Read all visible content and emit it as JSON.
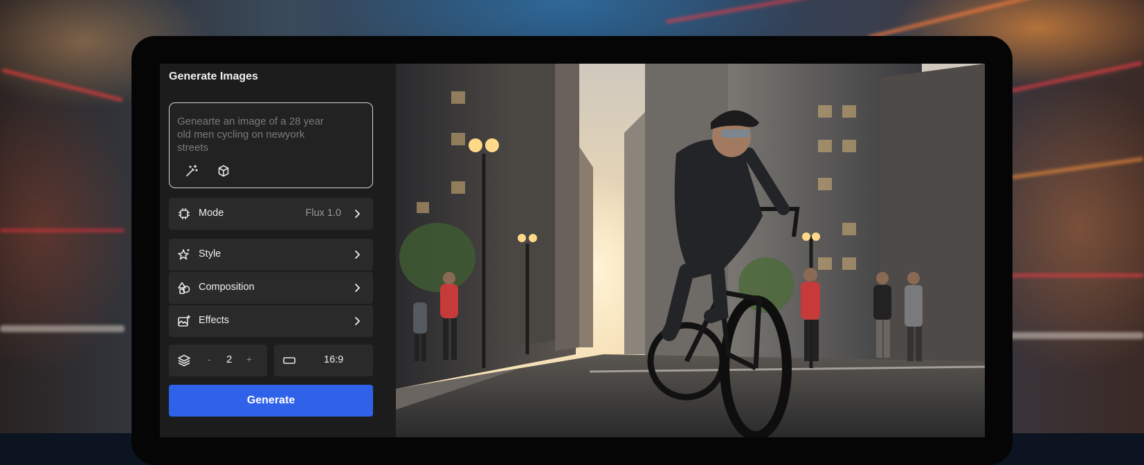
{
  "panel": {
    "title": "Generate Images",
    "prompt": {
      "text": "Genearte an image of a 28 year old men cycling on newyork streets",
      "icons": [
        "magic-wand-icon",
        "cube-icon"
      ]
    },
    "mode": {
      "label": "Mode",
      "value": "Flux 1.0",
      "icon": "chip-icon"
    },
    "style": {
      "label": "Style",
      "icon": "sparkle-star-icon"
    },
    "composition": {
      "label": "Composition",
      "icon": "shapes-icon"
    },
    "effects": {
      "label": "Effects",
      "icon": "image-sparkle-icon"
    },
    "count": {
      "decrement": "-",
      "value": "2",
      "increment": "+",
      "icon": "layers-icon"
    },
    "aspect": {
      "value": "16:9",
      "icon": "aspect-ratio-icon"
    },
    "generate_label": "Generate"
  },
  "colors": {
    "accent": "#2f62e8",
    "panel_bg": "#1c1c1c",
    "row_bg": "#2a2a2a"
  }
}
